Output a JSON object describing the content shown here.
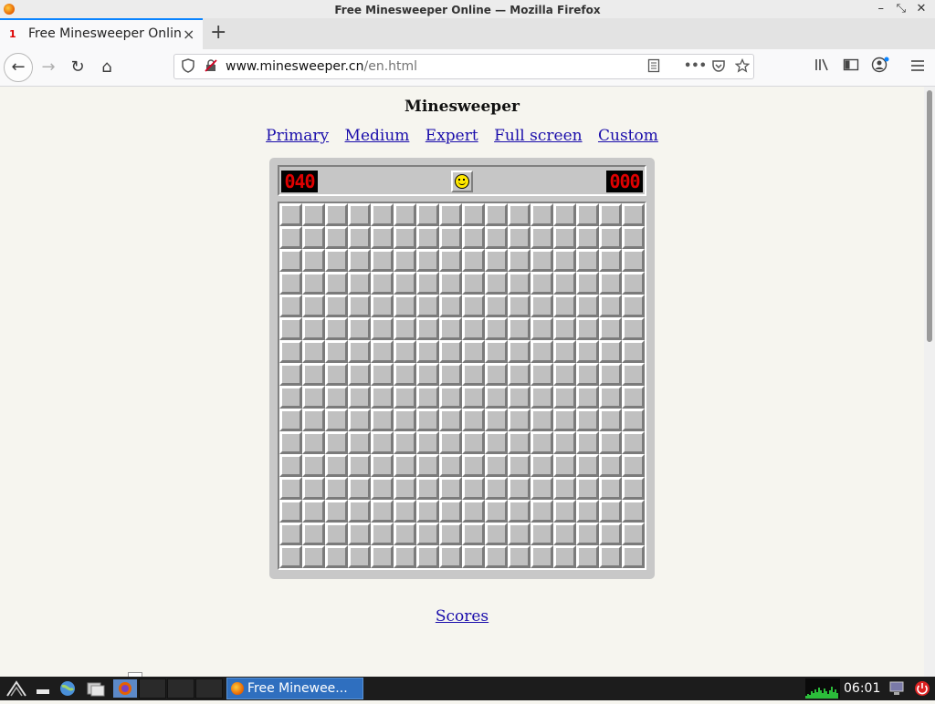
{
  "window": {
    "title": "Free Minesweeper Online — Mozilla Firefox",
    "controls": [
      "–",
      "⤡",
      "✕"
    ]
  },
  "tab": {
    "favicon": "1",
    "title": "Free Minesweeper Online",
    "close": "×",
    "new_tab": "+"
  },
  "nav": {
    "back": "←",
    "forward": "→",
    "reload": "↻",
    "home": "⌂",
    "url_domain": "www.minesweeper.cn",
    "url_path": "/en.html",
    "icons": [
      "shield-icon",
      "insecure-lock-icon",
      "reader-mode-icon",
      "more-icon",
      "pocket-icon",
      "bookmark-star-icon",
      "library-icon",
      "sidebar-icon",
      "account-icon",
      "menu-icon"
    ]
  },
  "page": {
    "title": "Minesweeper",
    "modes": [
      "Primary",
      "Medium",
      "Expert",
      "Full screen",
      "Custom"
    ],
    "mine_counter": "040",
    "timer": "000",
    "board": {
      "rows": 16,
      "cols": 16,
      "state": "all-covered"
    },
    "scores_link": "Scores"
  },
  "taskbar": {
    "app_label": "Free Minewee...",
    "clock": "06:01"
  },
  "colors": {
    "page_bg": "#f6f5ef",
    "link": "#1a0dab",
    "counter_digits": "#e00000",
    "cell": "#c0c0c0",
    "taskbar_active": "#2f6fbf"
  }
}
